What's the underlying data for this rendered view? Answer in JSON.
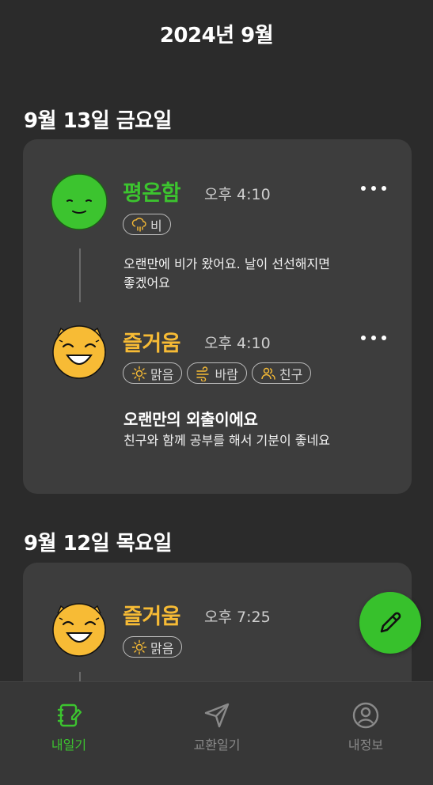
{
  "header": {
    "month": "2024년 9월"
  },
  "days": [
    {
      "date": "9월 13일 금요일",
      "entries": [
        {
          "face": "calm-face-icon",
          "emotion": "평온함",
          "emotion_color": "#3cc42f",
          "time": "오후 4:10",
          "tags": [
            {
              "icon": "rain-cloud-icon",
              "label": "비"
            }
          ],
          "title": "",
          "body": "오랜만에 비가 왔어요. 날이 선선해지면\n좋겠어요"
        },
        {
          "face": "joy-face-icon",
          "emotion": "즐거움",
          "emotion_color": "#f7bb35",
          "time": "오후 4:10",
          "tags": [
            {
              "icon": "sun-icon",
              "label": "맑음"
            },
            {
              "icon": "wind-icon",
              "label": "바람"
            },
            {
              "icon": "friends-icon",
              "label": "친구"
            }
          ],
          "title": "오랜만의 외출이에요",
          "body": "친구와 함께 공부를 해서 기분이 좋네요"
        }
      ]
    },
    {
      "date": "9월 12일 목요일",
      "entries": [
        {
          "face": "joy-face-icon",
          "emotion": "즐거움",
          "emotion_color": "#f7bb35",
          "time": "오후 7:25",
          "tags": [
            {
              "icon": "sun-icon",
              "label": "맑음"
            }
          ]
        }
      ]
    }
  ],
  "fab": {
    "icon": "pencil-icon"
  },
  "tabs": [
    {
      "label": "내일기",
      "icon": "diary-icon",
      "active": true
    },
    {
      "label": "교환일기",
      "icon": "send-icon",
      "active": false
    },
    {
      "label": "내정보",
      "icon": "profile-icon",
      "active": false
    }
  ],
  "colors": {
    "active_tab": "#3cc42f",
    "inactive_tab": "#8a8a8a",
    "background": "#2b2b2b",
    "card": "#3d3d3d"
  }
}
